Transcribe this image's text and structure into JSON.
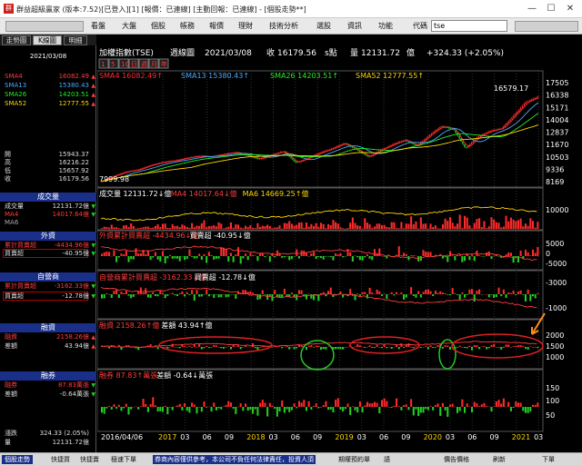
{
  "window": {
    "title": "群益超級贏家 (版本:7.52)[已登入][1] [報價：已連線] [主動回報：已連線] - [個股走勢**]",
    "icon_label": "群"
  },
  "window_buttons": [
    "—",
    "☐",
    "✕"
  ],
  "menu": {
    "items": [
      "看盤",
      "大盤",
      "個股",
      "帳務",
      "報價",
      "理財",
      "技術分析",
      "選股",
      "資訊",
      "功能"
    ],
    "code_label": "代碼",
    "code_value": "tse"
  },
  "tabs": [
    "走勢圖",
    "K線圖",
    "明細"
  ],
  "left": {
    "date": "2021/03/08",
    "sma": [
      {
        "name": "SMA4",
        "value": "16082.49"
      },
      {
        "name": "SMA13",
        "value": "15380.43"
      },
      {
        "name": "SMA26",
        "value": "14203.51"
      },
      {
        "name": "SMA52",
        "value": "12777.55"
      }
    ],
    "ohlc": [
      {
        "k": "開",
        "v": "15943.37"
      },
      {
        "k": "高",
        "v": "16216.22"
      },
      {
        "k": "低",
        "v": "15657.92"
      },
      {
        "k": "收",
        "v": "16179.56"
      }
    ],
    "volume": {
      "header": "成交量",
      "rows": [
        {
          "k": "成交量",
          "v": "12131.72億"
        },
        {
          "k": "MA4",
          "v": "14017.64億"
        },
        {
          "k": "MA6",
          "v": ""
        }
      ]
    },
    "foreign": {
      "header": "外資",
      "rows": [
        {
          "k": "累計買賣超",
          "v": "-4434.96億"
        },
        {
          "k": "買賣超",
          "v": "-40.95億"
        }
      ]
    },
    "dealer": {
      "header": "自營商",
      "rows": [
        {
          "k": "累計買賣超",
          "v": "-3162.33億"
        },
        {
          "k": "買賣超",
          "v": "-12.78億"
        }
      ]
    },
    "margin": {
      "header": "融資",
      "rows": [
        {
          "k": "融資",
          "v": "2158.26億"
        },
        {
          "k": "差額",
          "v": "43.94億"
        }
      ]
    },
    "short": {
      "header": "融券",
      "rows": [
        {
          "k": "融券",
          "v": "87.83萬張"
        },
        {
          "k": "差額",
          "v": "-0.64萬張"
        }
      ]
    },
    "bottom": [
      {
        "k": "漲跌",
        "v": "324.33 (2.05%)"
      },
      {
        "k": "量",
        "v": "12131.72億"
      }
    ]
  },
  "chart_header": {
    "name": "加權指數(TSE)",
    "period": "週線圖",
    "date": "2021/03/08",
    "close_label": "收",
    "close": "16179.56",
    "unit": "s點",
    "vol_label": "量",
    "vol": "12131.72",
    "vol_unit": "億",
    "change": "+324.33 (+2.05%)"
  },
  "period_buttons": [
    "1",
    "5",
    "10",
    "日",
    "週",
    "月",
    "年"
  ],
  "chart_data": {
    "type": "line",
    "title": "加權指數(TSE) 週線圖",
    "x_ticks": [
      "2016/04/06",
      "2017",
      "03",
      "06",
      "09",
      "2018",
      "03",
      "06",
      "09",
      "2019",
      "03",
      "06",
      "09",
      "2020",
      "03",
      "06",
      "09",
      "2021",
      "03"
    ],
    "price_axis": [
      "17505",
      "16338",
      "15171",
      "14004",
      "12837",
      "11670",
      "10503",
      "9336",
      "8169"
    ],
    "ylim": [
      7999.98,
      17600
    ],
    "high_label": "16579.17",
    "low_label": "7999.98",
    "legend": [
      {
        "name": "SMA4",
        "value": "16082.49",
        "color": "#ff2a2a"
      },
      {
        "name": "SMA13",
        "value": "15380.43",
        "color": "#4aa8ff"
      },
      {
        "name": "SMA26",
        "value": "14203.51",
        "color": "#22ee22"
      },
      {
        "name": "SMA52",
        "value": "12777.55",
        "color": "#ffd700"
      }
    ],
    "price_series": [
      8200,
      8700,
      9100,
      9300,
      9700,
      10000,
      10150,
      10400,
      10600,
      10520,
      10750,
      10950,
      10650,
      10300,
      10700,
      11050,
      9950,
      10400,
      10900,
      11300,
      11800,
      11200,
      10500,
      11150,
      11700,
      12100,
      11550,
      12550,
      13400,
      13150,
      11300,
      12400,
      12950,
      13200,
      14450,
      15700,
      16179.56
    ],
    "volume": {
      "title": "成交量",
      "value": "12131.72",
      "unit": "億",
      "ma4": "14017.64",
      "ma6": "14669.25",
      "axis": [
        "10000"
      ]
    },
    "foreign": {
      "title": "外資累計買賣超",
      "value": "-4434.96",
      "unit": "億",
      "sub_title": "買賣超",
      "sub_value": "-40.95",
      "axis": [
        "5000",
        "0",
        "-5000"
      ]
    },
    "dealer": {
      "title": "自營商累計買賣超",
      "value": "-3162.33",
      "unit": "億",
      "sub_title": "買賣超",
      "sub_value": "-12.78",
      "axis": [
        "-3000",
        "-1000"
      ]
    },
    "margin": {
      "title": "融資",
      "value": "2158.26",
      "unit": "億",
      "sub_title": "差額",
      "sub_value": "43.94",
      "axis": [
        "2000",
        "1500",
        "1000"
      ]
    },
    "short": {
      "title": "融券",
      "value": "87.83",
      "unit": "萬張",
      "sub_title": "差額",
      "sub_value": "-0.64",
      "axis": [
        "150",
        "100",
        "50"
      ]
    }
  },
  "colors": {
    "up": "#ff2a2a",
    "down": "#22cc22",
    "header": "#1a2f8a",
    "annotation": "#e02020"
  },
  "bottombar": {
    "items": [
      "個股走勢",
      "快捷買",
      "快捷賣",
      "極速下單"
    ],
    "notice": "券商內容僅供參考，本公司不負任何法律責任，投資人須",
    "right": [
      "期權預約單",
      "語",
      "",
      "價告價格",
      "刷新",
      "下單"
    ]
  }
}
